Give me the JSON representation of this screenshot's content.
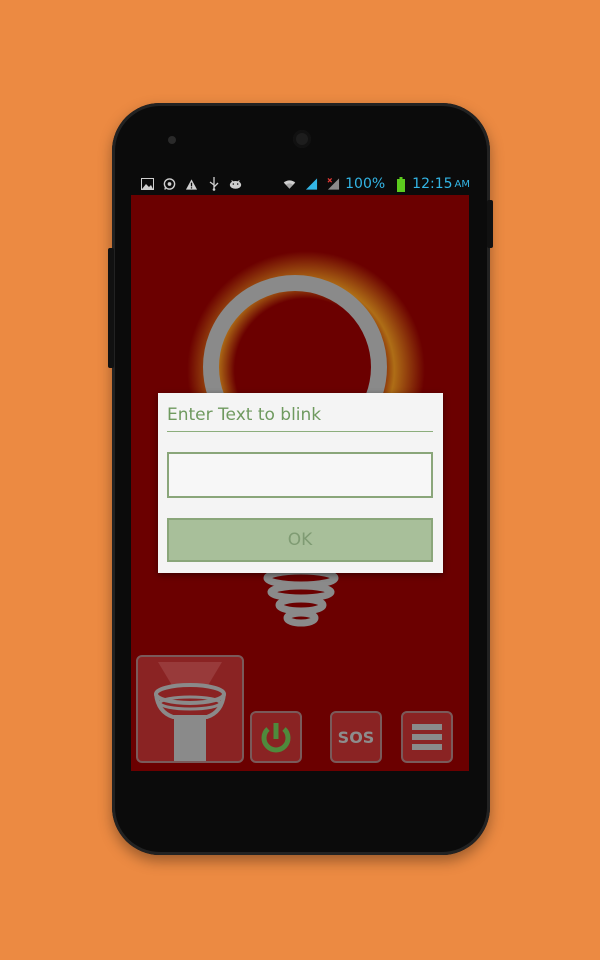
{
  "status_bar": {
    "icons": [
      "gallery-icon",
      "whatsapp-icon",
      "warning-icon",
      "usb-icon",
      "android-icon",
      "wifi-icon",
      "signal-icon",
      "signal-no-data-icon",
      "battery-icon"
    ],
    "battery_percent": "100%",
    "time": "12:15",
    "ampm": "AM"
  },
  "dialog": {
    "title": "Enter Text to blink",
    "input_value": "",
    "input_placeholder": "",
    "ok_label": "OK"
  },
  "controls": {
    "sos_label": "SOS",
    "torch_icon": "flashlight-icon",
    "power_icon": "power-icon",
    "menu_icon": "menu-icon"
  },
  "colors": {
    "background": "#EC8A42",
    "screen": "#6B0000",
    "accent_green": "#6F9A5F",
    "status_blue": "#33B5E5"
  }
}
